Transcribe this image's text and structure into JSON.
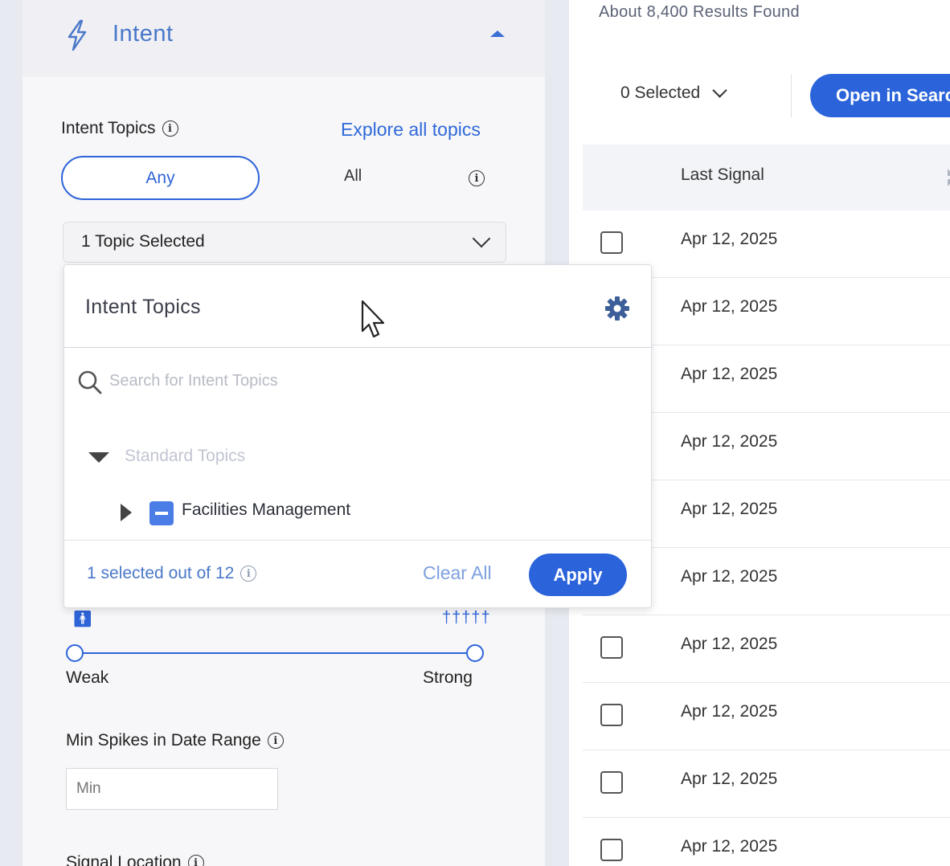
{
  "sidebar": {
    "intent": {
      "title": "Intent",
      "topics_label": "Intent Topics",
      "explore_link": "Explore all topics",
      "match_options": {
        "any": "Any",
        "all": "All"
      },
      "topic_select_value": "1 Topic Selected",
      "slider": {
        "min_label": "Weak",
        "max_label": "Strong"
      },
      "min_spikes_label": "Min Spikes in Date Range",
      "min_spikes_placeholder": "Min",
      "signal_location_label": "Signal Location"
    }
  },
  "popup": {
    "title": "Intent Topics",
    "search_placeholder": "Search for Intent Topics",
    "tree": {
      "group_label": "Standard Topics",
      "items": [
        {
          "label": "Facilities Management"
        }
      ]
    },
    "footer": {
      "selected_text": "1 selected out of 12",
      "clear_all": "Clear All",
      "apply": "Apply"
    }
  },
  "main": {
    "results_found": "About 8,400 Results Found",
    "selected_dropdown": "0 Selected",
    "open_button": "Open in Search",
    "table": {
      "columns": [
        "Last Signal"
      ],
      "rows": [
        {
          "last_signal": "Apr 12, 2025"
        },
        {
          "last_signal": "Apr 12, 2025"
        },
        {
          "last_signal": "Apr 12, 2025"
        },
        {
          "last_signal": "Apr 12, 2025"
        },
        {
          "last_signal": "Apr 12, 2025"
        },
        {
          "last_signal": "Apr 12, 2025"
        },
        {
          "last_signal": "Apr 12, 2025"
        },
        {
          "last_signal": "Apr 12, 2025"
        },
        {
          "last_signal": "Apr 12, 2025"
        },
        {
          "last_signal": "Apr 12, 2025"
        }
      ]
    }
  },
  "colors": {
    "accent": "#2a63da",
    "link": "#2f69d9",
    "sidebar_bg": "#f7f7f9"
  }
}
